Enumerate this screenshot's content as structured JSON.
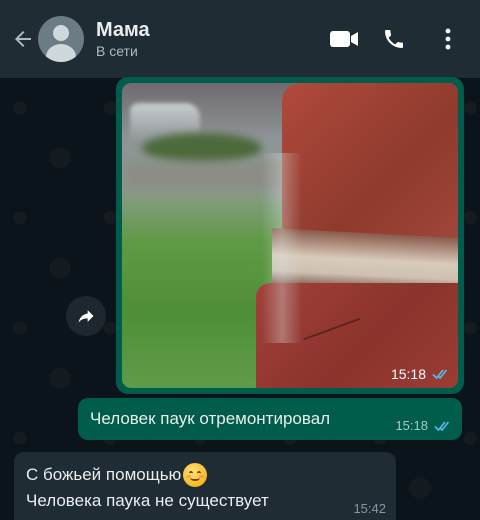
{
  "header": {
    "contact_name": "Мама",
    "status": "В сети",
    "icons": [
      "back-arrow-icon",
      "avatar",
      "video-call-icon",
      "phone-icon",
      "more-vert-icon"
    ]
  },
  "colors": {
    "header_bg": "#1f2c34",
    "chat_bg": "#0b141a",
    "outgoing_bubble": "#005c4b",
    "incoming_bubble": "#202c33",
    "read_ticks": "#53bdeb"
  },
  "messages": [
    {
      "direction": "outgoing",
      "type": "image",
      "time": "15:18",
      "status_icon": "double-check-read-icon"
    },
    {
      "direction": "outgoing",
      "type": "text",
      "text": "Человек паук отремонтировал",
      "time": "15:18",
      "status_icon": "double-check-read-icon"
    },
    {
      "direction": "incoming",
      "type": "text",
      "line1": "С божьей помощью",
      "line1_emoji": "smiling-face-emoji",
      "line2": "Человека паука не существует",
      "time": "15:42"
    }
  ]
}
